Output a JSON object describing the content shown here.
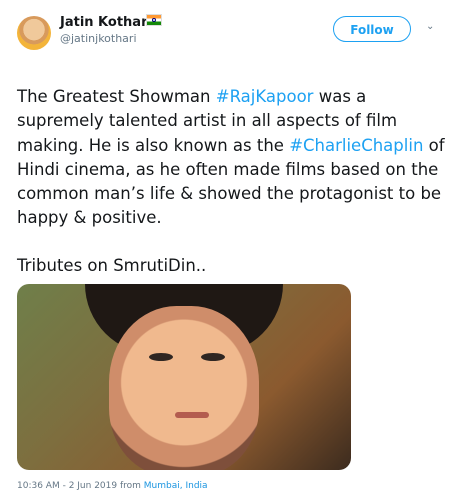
{
  "user": {
    "name": "Jatin Kothari",
    "handle": "@jatinjkothari",
    "flag_icon": "india-flag-icon"
  },
  "actions": {
    "follow_label": "Follow",
    "more_icon": "chevron-down-icon"
  },
  "tweet": {
    "text_part1": "The Greatest Showman ",
    "tag1": "#RajKapoor",
    "text_part2": " was a supremely talented artist in all aspects of film making. He is also known as the ",
    "tag2": "#CharlieChaplin",
    "text_part3": " of Hindi cinema, as he often made films based on the common man’s life & showed the protagonist to be happy & positive.",
    "tribute": "Tributes on SmrutiDin.."
  },
  "meta": {
    "time": "10:36 AM - 2 Jun 2019 from ",
    "place": "Mumbai, India"
  },
  "colors": {
    "accent": "#1da1f2",
    "text": "#14171a",
    "muted": "#657786"
  }
}
